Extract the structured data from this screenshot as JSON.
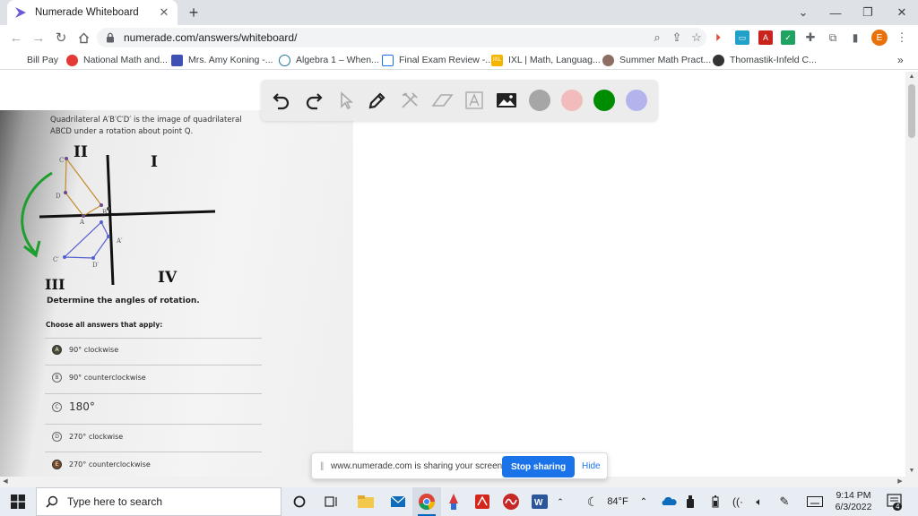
{
  "browser": {
    "tab_title": "Numerade Whiteboard",
    "url": "numerade.com/answers/whiteboard/",
    "profile_initial": "E"
  },
  "bookmarks": [
    {
      "label": "Bill Pay",
      "icon": "bill-pay-icon"
    },
    {
      "label": "National Math and...",
      "icon": "national-math-icon"
    },
    {
      "label": "Mrs. Amy Koning -...",
      "icon": "google-sites-icon"
    },
    {
      "label": "Algebra 1 – When...",
      "icon": "wordpress-icon"
    },
    {
      "label": "Final Exam Review -...",
      "icon": "page-icon"
    },
    {
      "label": "IXL | Math, Languag...",
      "icon": "ixl-icon"
    },
    {
      "label": "Summer Math Pract...",
      "icon": "summer-math-icon"
    },
    {
      "label": "Thomastik-Infeld C...",
      "icon": "thomastik-icon"
    }
  ],
  "whiteboard": {
    "tools": [
      "undo-icon",
      "redo-icon",
      "pointer-icon",
      "pen-icon",
      "tools-icon",
      "eraser-icon",
      "text-icon",
      "image-icon"
    ],
    "colors": [
      "#a6a6a6",
      "#f2bcbc",
      "#008c00",
      "#b4b4ec"
    ]
  },
  "problem": {
    "line1": "Quadrilateral A′B′C′D′ is the image of quadrilateral",
    "line2": "ABCD under a rotation about point Q.",
    "labels": {
      "quadrant_2": "II",
      "quadrant_1": "I",
      "quadrant_3": "III",
      "quadrant_4": "IV",
      "C": "C",
      "D": "D",
      "A": "A",
      "B": "B",
      "C_prime": "C′",
      "D_prime": "D′",
      "A_prime": "A′"
    },
    "instruction": "Determine the angles of rotation.",
    "choose": "Choose all answers that apply:",
    "choices": [
      {
        "letter": "A",
        "text": "90° clockwise"
      },
      {
        "letter": "B",
        "text": "90° counterclockwise"
      },
      {
        "letter": "C",
        "text": "180°"
      },
      {
        "letter": "D",
        "text": "270° clockwise"
      },
      {
        "letter": "E",
        "text": "270° counterclockwise"
      }
    ]
  },
  "share_bar": {
    "message": "www.numerade.com is sharing your screen.",
    "stop_label": "Stop sharing",
    "hide_label": "Hide"
  },
  "taskbar": {
    "search_placeholder": "Type here to search",
    "weather": "84°F",
    "time": "9:14 PM",
    "date": "6/3/2022",
    "notifications": "4"
  }
}
